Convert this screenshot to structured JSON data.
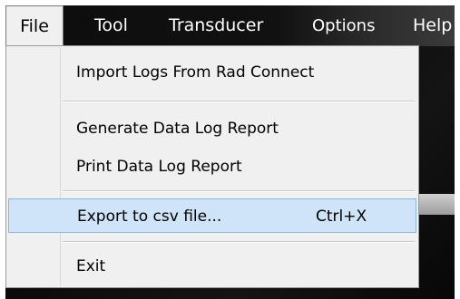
{
  "menubar": {
    "items": [
      {
        "label": "File"
      },
      {
        "label": "Tool"
      },
      {
        "label": "Transducer"
      },
      {
        "label": "Options"
      },
      {
        "label": "Help"
      }
    ]
  },
  "dropdown": {
    "items": [
      {
        "label": "Import Logs From Rad Connect"
      },
      {
        "label": "Generate Data Log Report"
      },
      {
        "label": "Print Data Log Report"
      },
      {
        "label": "Export to csv file...",
        "shortcut": "Ctrl+X"
      },
      {
        "label": "Exit"
      }
    ]
  },
  "colors": {
    "menu_background": "#f0f0f0",
    "highlight": "#cfe4f8",
    "highlight_border": "#8db4db",
    "menubar_background": "#0d0d0d"
  }
}
